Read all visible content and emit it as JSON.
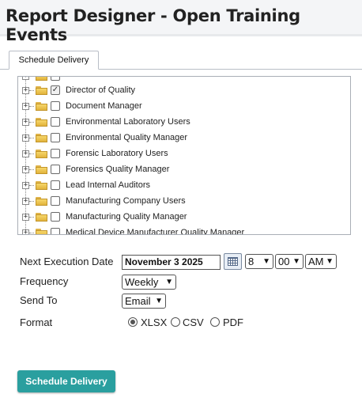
{
  "page": {
    "title": "Report Designer - Open Training Events"
  },
  "tabs": [
    {
      "label": "Schedule Delivery"
    }
  ],
  "tree": {
    "items": [
      {
        "label": "",
        "checked": false
      },
      {
        "label": "Director of Quality",
        "checked": true
      },
      {
        "label": "Document Manager",
        "checked": false
      },
      {
        "label": "Environmental Laboratory Users",
        "checked": false
      },
      {
        "label": "Environmental Quality Manager",
        "checked": false
      },
      {
        "label": "Forensic Laboratory Users",
        "checked": false
      },
      {
        "label": "Forensics Quality Manager",
        "checked": false
      },
      {
        "label": "Lead Internal Auditors",
        "checked": false
      },
      {
        "label": "Manufacturing Company Users",
        "checked": false
      },
      {
        "label": "Manufacturing Quality Manager",
        "checked": false
      },
      {
        "label": "Medical Device Manufacturer Quality Manager",
        "checked": false
      }
    ]
  },
  "form": {
    "next_execution": {
      "label": "Next Execution Date",
      "date_value": "November   3 2025",
      "hour": "8",
      "minute": "00",
      "ampm": "AM"
    },
    "frequency": {
      "label": "Frequency",
      "value": "Weekly"
    },
    "send_to": {
      "label": "Send To",
      "value": "Email"
    },
    "format": {
      "label": "Format",
      "options": [
        {
          "label": "XLSX",
          "selected": true
        },
        {
          "label": "CSV",
          "selected": false
        },
        {
          "label": "PDF",
          "selected": false
        }
      ]
    }
  },
  "actions": {
    "schedule_delivery": "Schedule Delivery"
  },
  "colors": {
    "accent": "#2a9f9f",
    "folder": "#f0c85a",
    "header_bg": "#f4f5f7"
  },
  "icons": {
    "folder": "folder-icon",
    "expander": "expand-plus-icon",
    "calendar": "calendar-icon"
  }
}
